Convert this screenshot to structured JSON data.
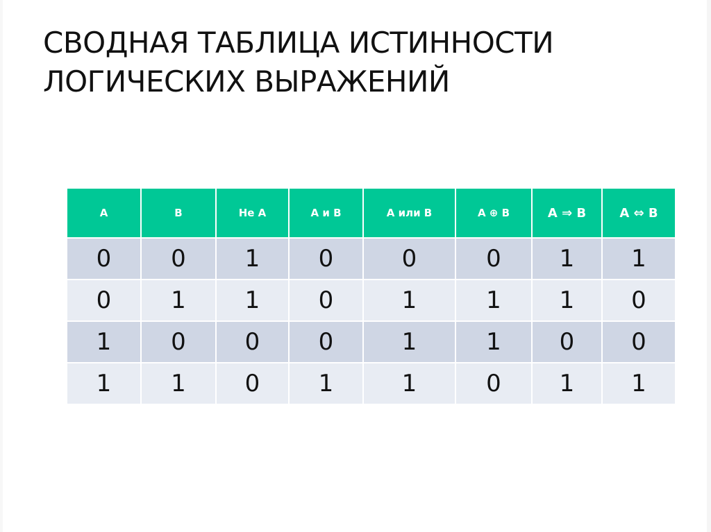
{
  "title": {
    "line1": "СВОДНАЯ ТАБЛИЦА ИСТИННОСТИ",
    "line2": "ЛОГИЧЕСКИХ ВЫРАЖЕНИЙ"
  },
  "colors": {
    "header_bg": "#00c896",
    "row_odd_bg": "#cfd6e4",
    "row_even_bg": "#e8ecf3"
  },
  "table": {
    "headers": [
      "А",
      "В",
      "Не А",
      "А и В",
      "А или В",
      "А ⊕ В",
      "А ⇒ В",
      "А ⇔ В"
    ],
    "rows": [
      [
        "0",
        "0",
        "1",
        "0",
        "0",
        "0",
        "1",
        "1"
      ],
      [
        "0",
        "1",
        "1",
        "0",
        "1",
        "1",
        "1",
        "0"
      ],
      [
        "1",
        "0",
        "0",
        "0",
        "1",
        "1",
        "0",
        "0"
      ],
      [
        "1",
        "1",
        "0",
        "1",
        "1",
        "0",
        "1",
        "1"
      ]
    ]
  }
}
